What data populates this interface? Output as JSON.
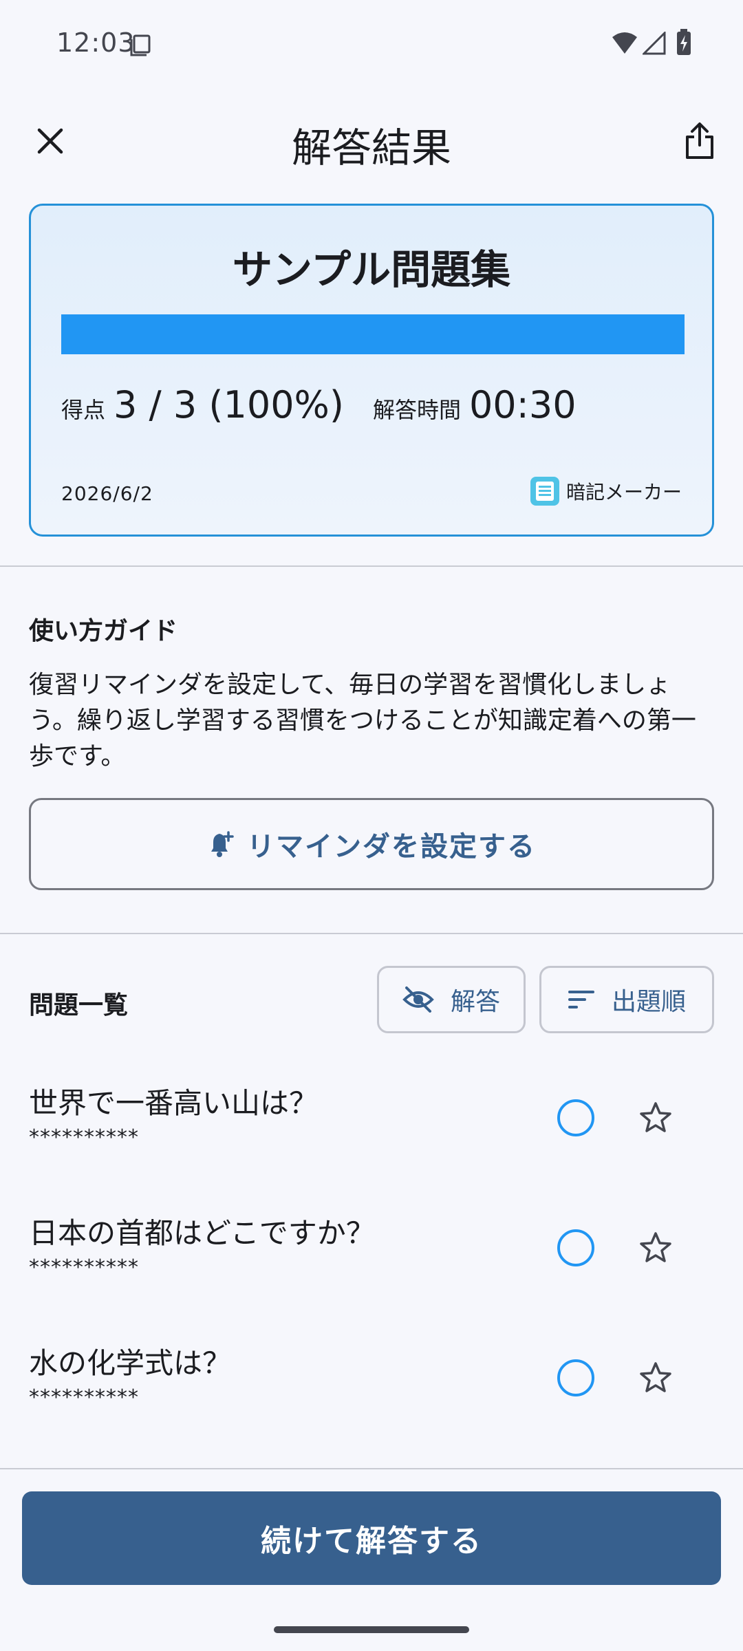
{
  "status_bar": {
    "time": "12:03"
  },
  "app_bar": {
    "title": "解答結果"
  },
  "card": {
    "title": "サンプル問題集",
    "progress": 1.0,
    "score_label": "得点",
    "score_value": "3 / 3 (100%)",
    "time_label": "解答時間",
    "time_value": "00:30",
    "date": "2026/6/2",
    "brand": "暗記メーカー"
  },
  "guide": {
    "heading": "使い方ガイド",
    "body": "復習リマインダを設定して、毎日の学習を習慣化しましょう。繰り返し学習する習慣をつけることが知識定着への第一歩です。",
    "button_label": "リマインダを設定する"
  },
  "question_list": {
    "heading": "問題一覧",
    "answer_toggle_label": "解答",
    "sort_label": "出題順",
    "items": [
      {
        "question": "世界で一番高い山は？",
        "answer": "**********"
      },
      {
        "question": "日本の首都はどこですか？",
        "answer": "**********"
      },
      {
        "question": "水の化学式は？",
        "answer": "**********"
      }
    ]
  },
  "footer": {
    "continue_label": "続けて解答する"
  },
  "colors": {
    "accent": "#2196f3",
    "primary": "#37608e",
    "card_border": "#2591d8"
  }
}
